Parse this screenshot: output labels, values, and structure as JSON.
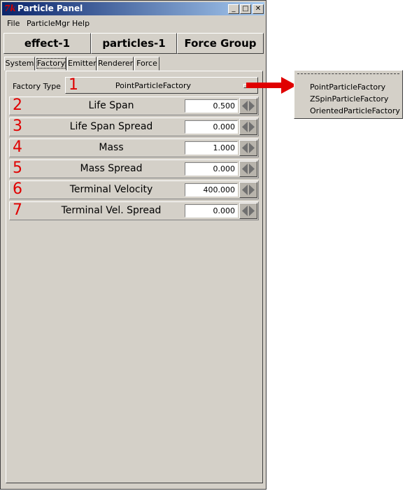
{
  "window": {
    "title": "Particle Panel",
    "icon": "tk-feather-icon",
    "controls": [
      "minimize-icon",
      "maximize-icon",
      "close-icon"
    ]
  },
  "menubar": [
    {
      "label": "File"
    },
    {
      "label": "ParticleMgr"
    },
    {
      "label": "Help"
    }
  ],
  "top_buttons": [
    "effect-1",
    "particles-1",
    "Force Group"
  ],
  "tabs": [
    {
      "label": "System",
      "active": false
    },
    {
      "label": "Factory",
      "active": true
    },
    {
      "label": "Emitter",
      "active": false
    },
    {
      "label": "Renderer",
      "active": false
    },
    {
      "label": "Force",
      "active": false
    }
  ],
  "factory_type": {
    "label": "Factory Type",
    "annotation": "1",
    "value": "PointParticleFactory"
  },
  "parameters": [
    {
      "annotation": "2",
      "label": "Life Span",
      "value": "0.500"
    },
    {
      "annotation": "3",
      "label": "Life Span Spread",
      "value": "0.000"
    },
    {
      "annotation": "4",
      "label": "Mass",
      "value": "1.000"
    },
    {
      "annotation": "5",
      "label": "Mass Spread",
      "value": "0.000"
    },
    {
      "annotation": "6",
      "label": "Terminal Velocity",
      "value": "400.000"
    },
    {
      "annotation": "7",
      "label": "Terminal Vel. Spread",
      "value": "0.000"
    }
  ],
  "factory_options": [
    "PointParticleFactory",
    "ZSpinParticleFactory",
    "OrientedParticleFactory"
  ],
  "colors": {
    "annotation": "#e00000",
    "titlebar": "#0a246a",
    "panel": "#d4d0c8"
  }
}
